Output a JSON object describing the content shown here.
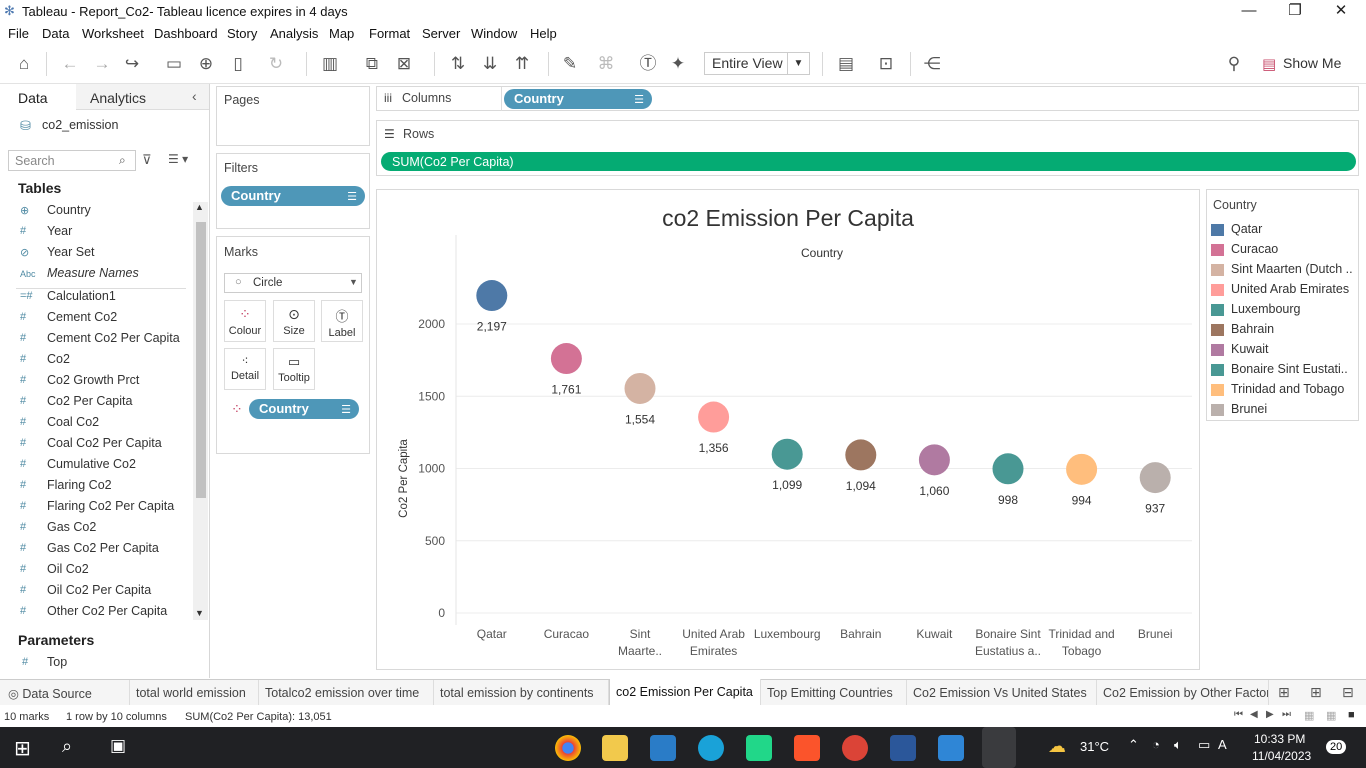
{
  "window": {
    "title": "Tableau - Report_Co2- Tableau licence expires in 4 days",
    "minimize": "—",
    "restore": "❐",
    "close": "✕"
  },
  "menu": [
    "File",
    "Data",
    "Worksheet",
    "Dashboard",
    "Story",
    "Analysis",
    "Map",
    "Format",
    "Server",
    "Window",
    "Help"
  ],
  "toolbar": {
    "fit_value": "Entire View",
    "show_me": "Show Me"
  },
  "left": {
    "tab_data": "Data",
    "tab_analytics": "Analytics",
    "datasource": "co2_emission",
    "search_placeholder": "Search",
    "tables_heading": "Tables",
    "parameters_heading": "Parameters",
    "fields": [
      {
        "icon": "globe",
        "label": "Country"
      },
      {
        "icon": "#",
        "label": "Year"
      },
      {
        "icon": "set",
        "label": "Year Set"
      },
      {
        "icon": "Abc",
        "label": "Measure Names"
      },
      {
        "icon": "#",
        "label": "Calculation1"
      },
      {
        "icon": "#",
        "label": "Cement Co2"
      },
      {
        "icon": "#",
        "label": "Cement Co2 Per Capita"
      },
      {
        "icon": "#",
        "label": "Co2"
      },
      {
        "icon": "#",
        "label": "Co2 Growth Prct"
      },
      {
        "icon": "#",
        "label": "Co2 Per Capita"
      },
      {
        "icon": "#",
        "label": "Coal Co2"
      },
      {
        "icon": "#",
        "label": "Coal Co2 Per Capita"
      },
      {
        "icon": "#",
        "label": "Cumulative Co2"
      },
      {
        "icon": "#",
        "label": "Flaring Co2"
      },
      {
        "icon": "#",
        "label": "Flaring Co2 Per Capita"
      },
      {
        "icon": "#",
        "label": "Gas Co2"
      },
      {
        "icon": "#",
        "label": "Gas Co2 Per Capita"
      },
      {
        "icon": "#",
        "label": "Oil Co2"
      },
      {
        "icon": "#",
        "label": "Oil Co2 Per Capita"
      },
      {
        "icon": "#",
        "label": "Other Co2 Per Capita"
      }
    ],
    "parameters": [
      {
        "icon": "#",
        "label": "Top"
      }
    ]
  },
  "cards": {
    "pages": "Pages",
    "filters": "Filters",
    "filter_pill": "Country",
    "marks": "Marks",
    "mark_type": "Circle",
    "buttons": [
      "Colour",
      "Size",
      "Label",
      "Detail",
      "Tooltip"
    ],
    "color_pill": "Country"
  },
  "shelves": {
    "columns_label": "Columns",
    "columns_pill": "Country",
    "rows_label": "Rows",
    "rows_pill": "SUM(Co2 Per Capita)"
  },
  "legend": {
    "title": "Country"
  },
  "chart_data": {
    "type": "scatter",
    "title": "co2 Emission Per Capita",
    "header": "Country",
    "ylabel": "Co2 Per Capita",
    "ylim": [
      0,
      2300
    ],
    "yticks": [
      0,
      500,
      1000,
      1500,
      2000
    ],
    "grid": true,
    "legend_position": "right",
    "categories": [
      "Qatar",
      "Curacao",
      "Sint Maarten (Dutch part)",
      "United Arab Emirates",
      "Luxembourg",
      "Bahrain",
      "Kuwait",
      "Bonaire Sint Eustatius and Saba",
      "Trinidad and Tobago",
      "Brunei"
    ],
    "tick_labels": [
      [
        "Qatar"
      ],
      [
        "Curacao"
      ],
      [
        "Sint",
        "Maarte.."
      ],
      [
        "United Arab",
        "Emirates"
      ],
      [
        "Luxembourg"
      ],
      [
        "Bahrain"
      ],
      [
        "Kuwait"
      ],
      [
        "Bonaire Sint",
        "Eustatius a.."
      ],
      [
        "Trinidad and",
        "Tobago"
      ],
      [
        "Brunei"
      ]
    ],
    "legend_labels": [
      "Qatar",
      "Curacao",
      "Sint Maarten (Dutch ..",
      "United Arab Emirates",
      "Luxembourg",
      "Bahrain",
      "Kuwait",
      "Bonaire Sint Eustati..",
      "Trinidad and Tobago",
      "Brunei"
    ],
    "values": [
      2197,
      1761,
      1554,
      1356,
      1099,
      1094,
      1060,
      998,
      994,
      937
    ],
    "value_labels": [
      "2,197",
      "1,761",
      "1,554",
      "1,356",
      "1,099",
      "1,094",
      "1,060",
      "998",
      "994",
      "937"
    ],
    "colors": [
      "#4e79a7",
      "#d37295",
      "#d4b3a3",
      "#ff9d9a",
      "#499894",
      "#9d7660",
      "#b07aa1",
      "#499894",
      "#ffbe7d",
      "#bab0ac"
    ]
  },
  "sheets": [
    {
      "label": "Data Source"
    },
    {
      "label": "total world emission"
    },
    {
      "label": "Totalco2 emission over time"
    },
    {
      "label": "total emission by continents"
    },
    {
      "label": "co2 Emission Per Capita",
      "selected": true
    },
    {
      "label": "Top Emitting Countries"
    },
    {
      "label": "Co2 Emission Vs United States"
    },
    {
      "label": "Co2 Emission by Other Factor"
    }
  ],
  "status": {
    "marks": "10 marks",
    "rows_cols": "1 row by 10 columns",
    "sum": "SUM(Co2 Per Capita): 13,051"
  },
  "taskbar": {
    "temp": "31°C",
    "time": "10:33 PM",
    "date": "11/04/2023",
    "notif": "20"
  }
}
